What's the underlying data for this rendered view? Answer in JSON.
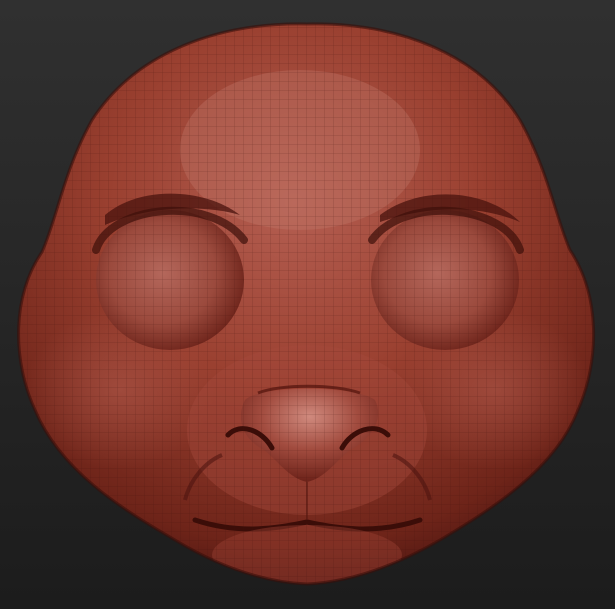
{
  "viewport": {
    "background_top": "#303030",
    "background_bottom": "#1c1c1c"
  },
  "model": {
    "material_base": "#8e3526",
    "material_light": "#c8776a",
    "material_dark": "#4a1410",
    "wireframe_visible": true
  }
}
